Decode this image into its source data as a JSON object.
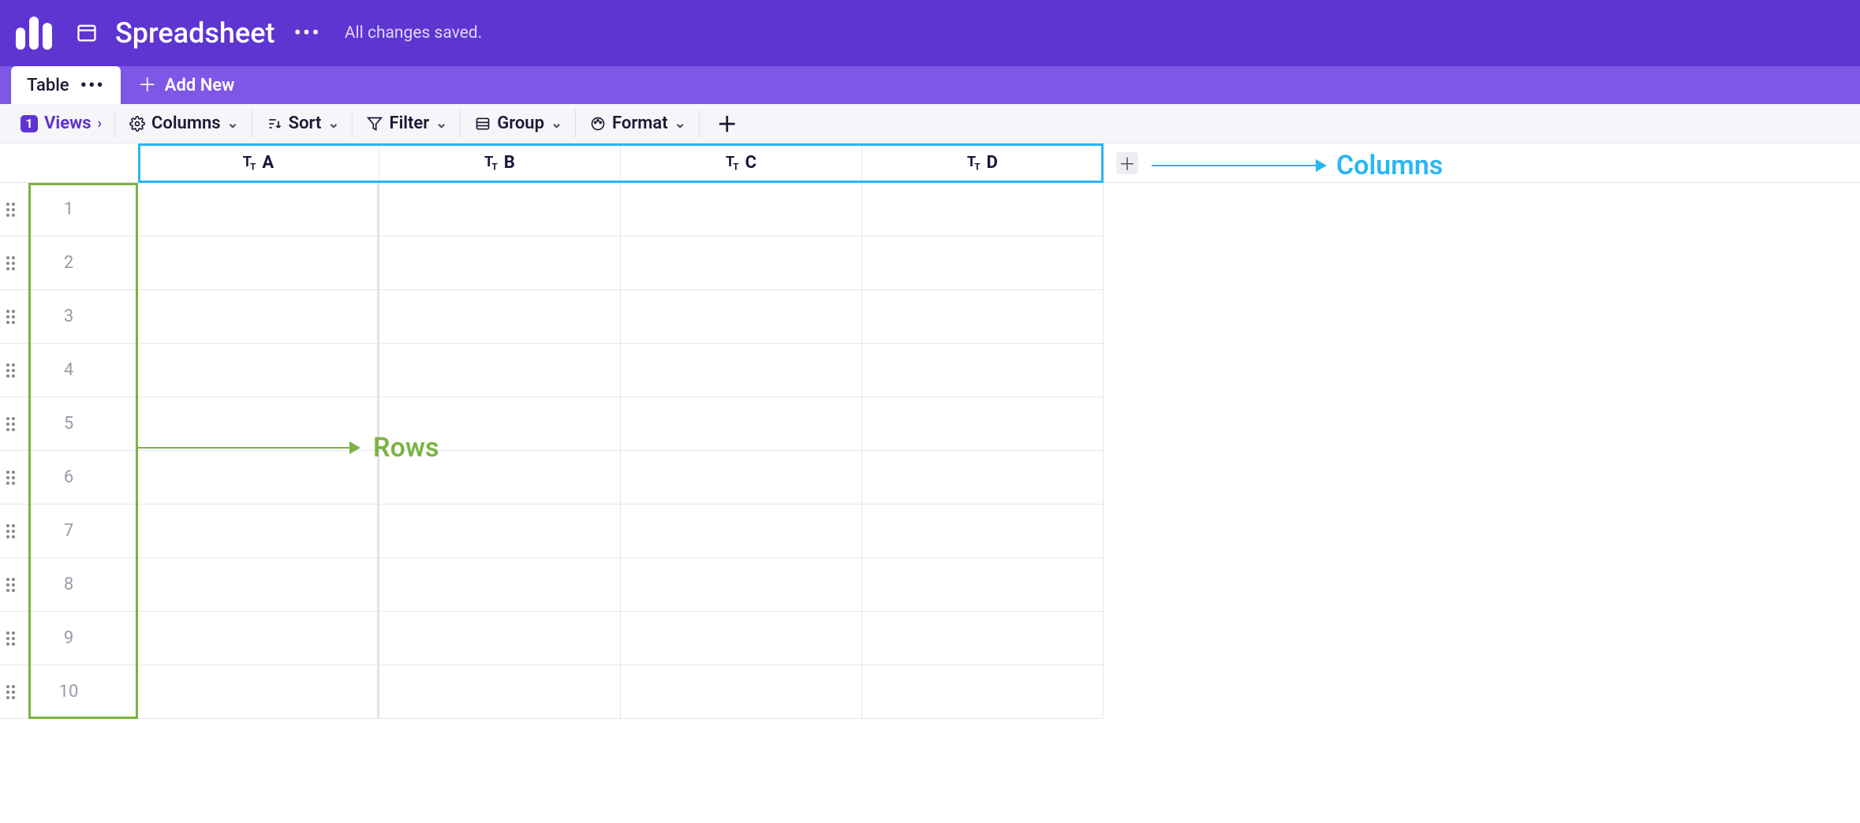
{
  "header": {
    "title": "Spreadsheet",
    "status": "All changes saved."
  },
  "tabs": {
    "active": "Table",
    "add_new": "Add New"
  },
  "toolbar": {
    "views_count": "1",
    "views_label": "Views",
    "columns": "Columns",
    "sort": "Sort",
    "filter": "Filter",
    "group": "Group",
    "format": "Format"
  },
  "grid": {
    "columns": [
      "A",
      "B",
      "C",
      "D"
    ],
    "rows": [
      "1",
      "2",
      "3",
      "4",
      "5",
      "6",
      "7",
      "8",
      "9",
      "10"
    ]
  },
  "annotations": {
    "columns_label": "Columns",
    "rows_label": "Rows"
  }
}
